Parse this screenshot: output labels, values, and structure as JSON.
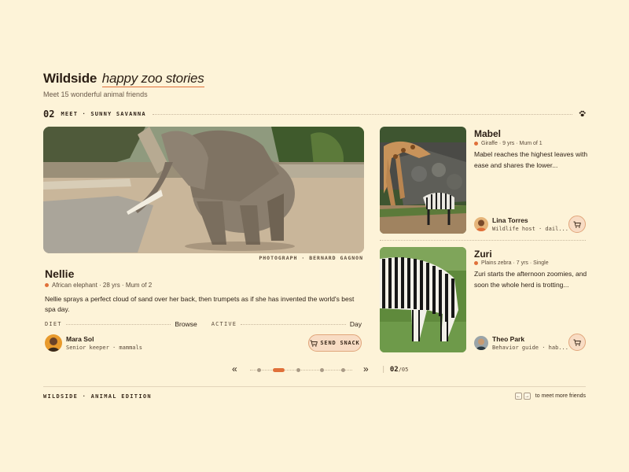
{
  "header": {
    "brand": "Wildside",
    "tagline": "happy zoo stories",
    "subtitle": "Meet 15 wonderful animal friends"
  },
  "section": {
    "number": "02",
    "label": "MEET · SUNNY SAVANNA",
    "icon": "paw-icon"
  },
  "featured": {
    "photo_credit": "PHOTOGRAPH · BERNARD GAGNON",
    "name": "Nellie",
    "meta": "African elephant · 28 yrs · Mum of 2",
    "description": "Nellie sprays a perfect cloud of sand over her back, then trumpets as if she has invented the world's best spa day.",
    "stats": [
      {
        "label": "DIET",
        "value": "Browse"
      },
      {
        "label": "ACTIVE",
        "value": "Day"
      }
    ],
    "keeper": {
      "name": "Mara Sol",
      "role": "Senior keeper · mammals"
    },
    "snack_label": "SEND SNACK"
  },
  "side_cards": [
    {
      "name": "Mabel",
      "meta": "Giraffe · 9 yrs · Mum of 1",
      "description": "Mabel reaches the highest leaves with ease and shares the lower...",
      "keeper": {
        "name": "Lina Torres",
        "role": "Wildlife host · dail..."
      }
    },
    {
      "name": "Zuri",
      "meta": "Plains zebra · 7 yrs · Single",
      "description": "Zuri starts the afternoon zoomies, and soon the whole herd is trotting...",
      "keeper": {
        "name": "Theo Park",
        "role": "Behavior guide · hab..."
      }
    }
  ],
  "pager": {
    "prev": "«",
    "next": "»",
    "dots": 5,
    "active": 2,
    "current": "02",
    "total": "/05"
  },
  "footer": {
    "left": "WILDSIDE · ANIMAL EDITION",
    "key_prev": "←",
    "key_next": "→",
    "hint": "to meet more friends"
  },
  "colors": {
    "background": "#fdf3d8",
    "accent": "#e0703a",
    "button_fill": "#f8dcc4"
  }
}
